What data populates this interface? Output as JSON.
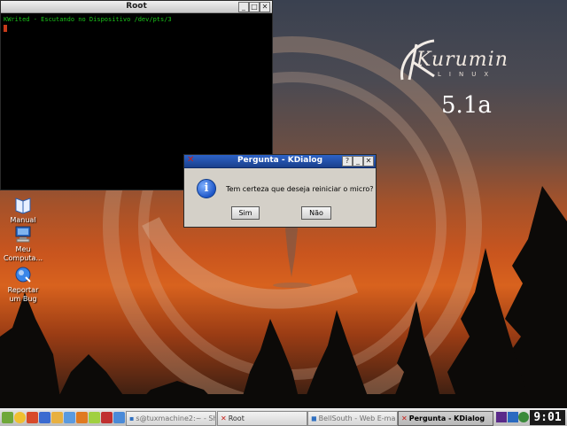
{
  "desktop": {
    "logo": {
      "text": "Kurumin",
      "sub": "LINUX",
      "version": "5.1a"
    },
    "icons": [
      {
        "name": "manual",
        "label": "Manual"
      },
      {
        "name": "meu-computador",
        "label": "Meu Computa..."
      },
      {
        "name": "reportar-bug",
        "label": "Reportar um Bug"
      }
    ]
  },
  "terminal": {
    "title": "Root",
    "line": "KWrited - Escutando no Dispositivo /dev/pts/3"
  },
  "dialog": {
    "title": "Pergunta - KDialog",
    "message": "Tem certeza que deseja reiniciar o micro?",
    "help_btn": "?",
    "yes_label": "Sim",
    "no_label": "Não"
  },
  "window_buttons": {
    "minimize": "_",
    "maximize": "□",
    "close": "✕"
  },
  "taskbar": {
    "tasks": [
      {
        "label": "s@tuxmachine2:~ - Sh",
        "active": false
      },
      {
        "label": "Root",
        "active": false
      },
      {
        "label": "BellSouth - Web E-ma",
        "active": false
      },
      {
        "label": "Pergunta - KDialog",
        "active": true
      }
    ],
    "clock": "9:01"
  },
  "colors": {
    "terminal_text": "#19c419",
    "dialog_title": "#2d63c8",
    "kde_close": "#c8201a"
  }
}
